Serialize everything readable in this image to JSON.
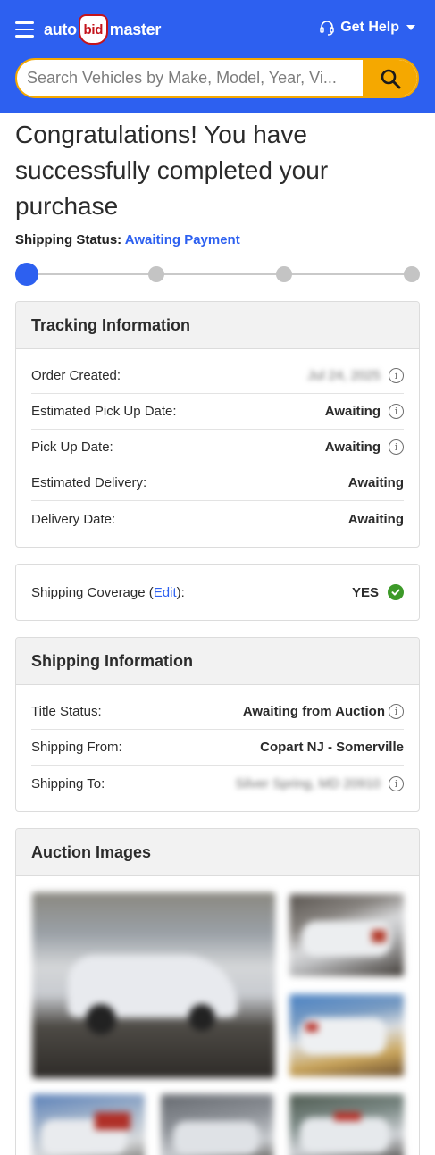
{
  "header": {
    "logo_left": "auto",
    "logo_mid": "bid",
    "logo_right": "master",
    "help_label": "Get Help"
  },
  "search": {
    "placeholder": "Search Vehicles by Make, Model, Year, Vi..."
  },
  "page": {
    "title": "Congratulations! You have successfully completed your purchase",
    "status_label": "Shipping Status:",
    "status_value": "Awaiting Payment"
  },
  "progress": {
    "steps": 4,
    "current_step": 1
  },
  "tracking": {
    "title": "Tracking Information",
    "rows": [
      {
        "label": "Order Created:",
        "value": "Jul 24, 2025"
      },
      {
        "label": "Estimated Pick Up Date:",
        "value": "Awaiting"
      },
      {
        "label": "Pick Up Date:",
        "value": "Awaiting"
      },
      {
        "label": "Estimated Delivery:",
        "value": "Awaiting"
      },
      {
        "label": "Delivery Date:",
        "value": "Awaiting"
      }
    ]
  },
  "coverage": {
    "label_prefix": "Shipping Coverage (",
    "edit_label": "Edit",
    "label_suffix": "):",
    "value": "YES"
  },
  "shipping": {
    "title": "Shipping Information",
    "rows": [
      {
        "label": "Title Status:",
        "value": "Awaiting from Auction"
      },
      {
        "label": "Shipping From:",
        "value": "Copart NJ - Somerville"
      },
      {
        "label": "Shipping To:",
        "value": "Silver Spring, MD 20910"
      }
    ]
  },
  "auction": {
    "title": "Auction Images"
  },
  "colors": {
    "brand_blue": "#2d60f0",
    "accent_orange": "#f5a800",
    "success_green": "#3d9a29"
  }
}
